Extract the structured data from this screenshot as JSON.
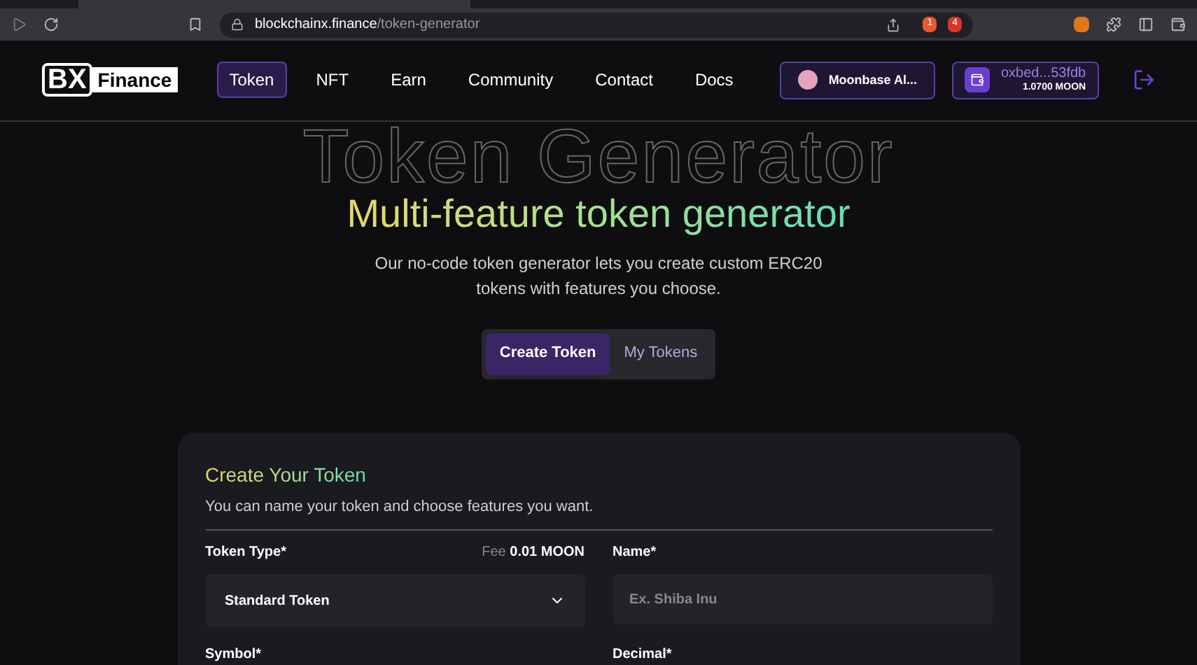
{
  "browser": {
    "url_domain": "blockchainx.finance",
    "url_path": "/token-generator",
    "shield_count": "1",
    "alert_count": "4"
  },
  "nav": {
    "logo_mark": "BX",
    "logo_text": "Finance",
    "items": [
      {
        "label": "Token",
        "selected": true
      },
      {
        "label": "NFT",
        "selected": false
      },
      {
        "label": "Earn",
        "selected": false
      },
      {
        "label": "Community",
        "selected": false
      },
      {
        "label": "Contact",
        "selected": false
      },
      {
        "label": "Docs",
        "selected": false
      }
    ],
    "network": "Moonbase Al...",
    "wallet": {
      "address": "oxbed...53fdb",
      "balance": "1.0700 MOON"
    }
  },
  "hero": {
    "backdrop": "Token Generator",
    "title": "Multi-feature token generator",
    "subtitle": "Our no-code token generator lets you create custom ERC20 tokens with features you choose.",
    "tabs": [
      {
        "label": "Create Token",
        "selected": true
      },
      {
        "label": "My Tokens",
        "selected": false
      }
    ]
  },
  "form": {
    "title": "Create Your Token",
    "subtitle": "You can name your token and choose features you want.",
    "token_type": {
      "label": "Token Type*",
      "fee_label": "Fee",
      "fee_value": "0.01 MOON",
      "value": "Standard Token"
    },
    "name": {
      "label": "Name*",
      "placeholder": "Ex. Shiba Inu"
    },
    "symbol": {
      "label": "Symbol*"
    },
    "decimal": {
      "label": "Decimal*"
    }
  }
}
